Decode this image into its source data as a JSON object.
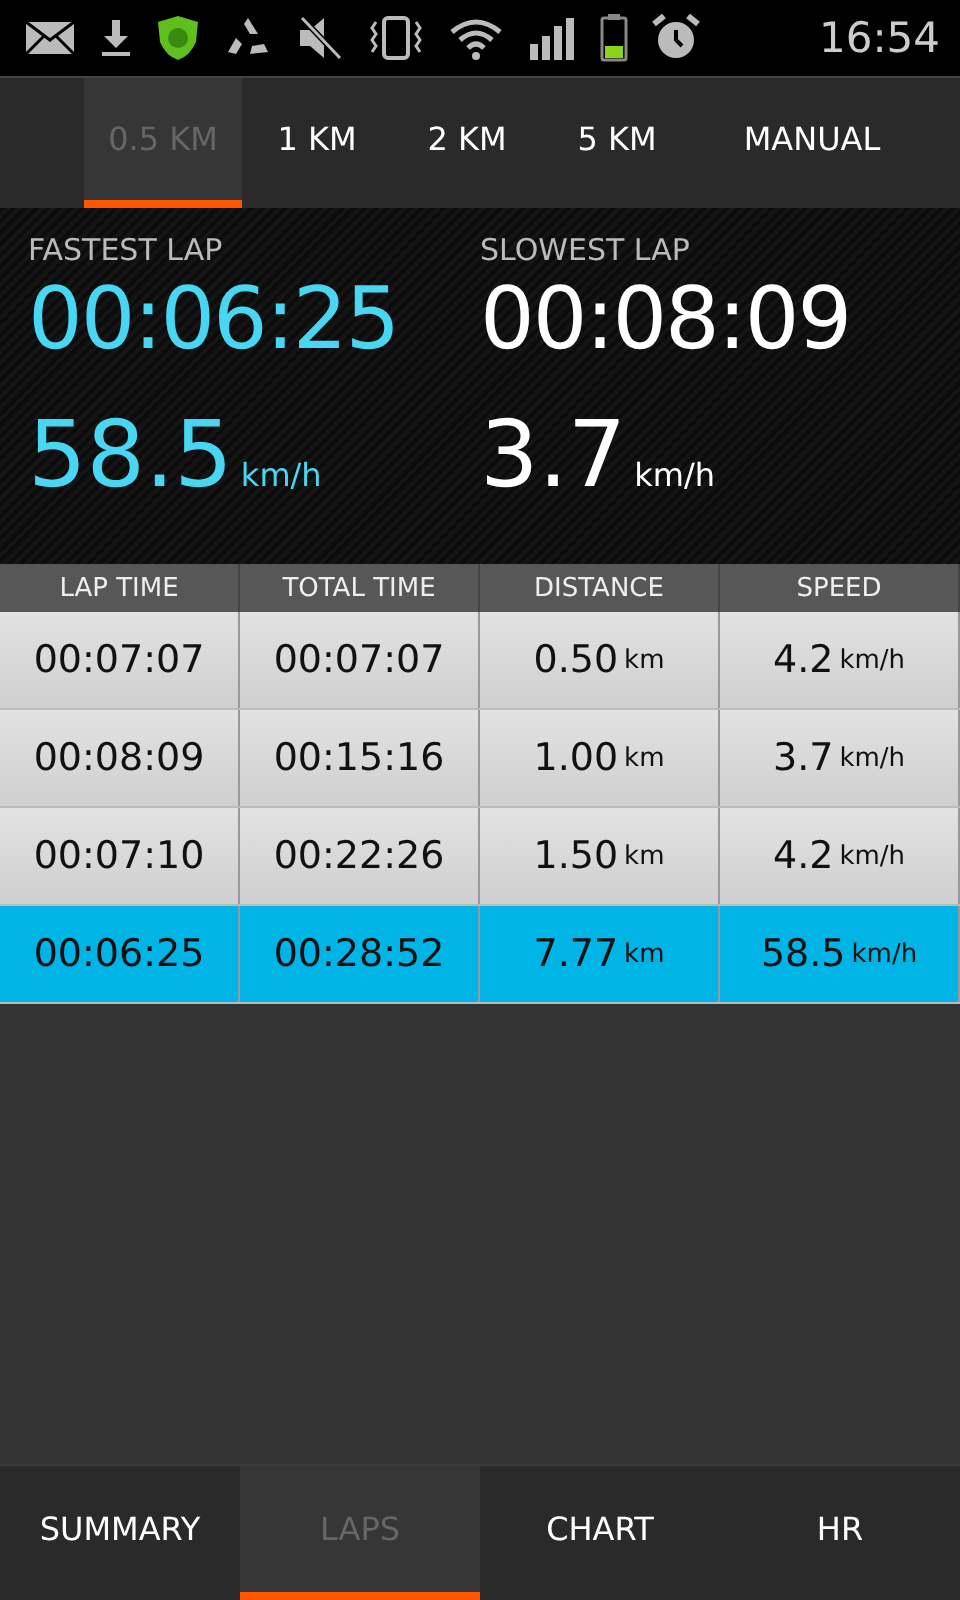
{
  "status_bar": {
    "time": "16:54"
  },
  "distance_tabs": [
    {
      "label": "0.5 KM",
      "selected": true
    },
    {
      "label": "1 KM",
      "selected": false
    },
    {
      "label": "2 KM",
      "selected": false
    },
    {
      "label": "5 KM",
      "selected": false
    },
    {
      "label": "MANUAL",
      "selected": false
    }
  ],
  "summary": [
    {
      "kind": "fastest",
      "label": "FASTEST LAP",
      "time": "00:06:25",
      "speed": "58.5",
      "unit": "km/h"
    },
    {
      "kind": "slowest",
      "label": "SLOWEST LAP",
      "time": "00:08:09",
      "speed": "3.7",
      "unit": "km/h"
    }
  ],
  "table": {
    "columns": [
      "LAP TIME",
      "TOTAL TIME",
      "DISTANCE",
      "SPEED"
    ],
    "rows": [
      {
        "selected": false,
        "lap_time": "00:07:07",
        "total_time": "00:07:07",
        "distance": "0.50",
        "distance_unit": "km",
        "speed": "4.2",
        "speed_unit": "km/h"
      },
      {
        "selected": false,
        "lap_time": "00:08:09",
        "total_time": "00:15:16",
        "distance": "1.00",
        "distance_unit": "km",
        "speed": "3.7",
        "speed_unit": "km/h"
      },
      {
        "selected": false,
        "lap_time": "00:07:10",
        "total_time": "00:22:26",
        "distance": "1.50",
        "distance_unit": "km",
        "speed": "4.2",
        "speed_unit": "km/h"
      },
      {
        "selected": true,
        "lap_time": "00:06:25",
        "total_time": "00:28:52",
        "distance": "7.77",
        "distance_unit": "km",
        "speed": "58.5",
        "speed_unit": "km/h"
      }
    ]
  },
  "bottom_tabs": [
    {
      "label": "SUMMARY",
      "selected": false
    },
    {
      "label": "LAPS",
      "selected": true
    },
    {
      "label": "CHART",
      "selected": false
    },
    {
      "label": "HR",
      "selected": false
    }
  ]
}
